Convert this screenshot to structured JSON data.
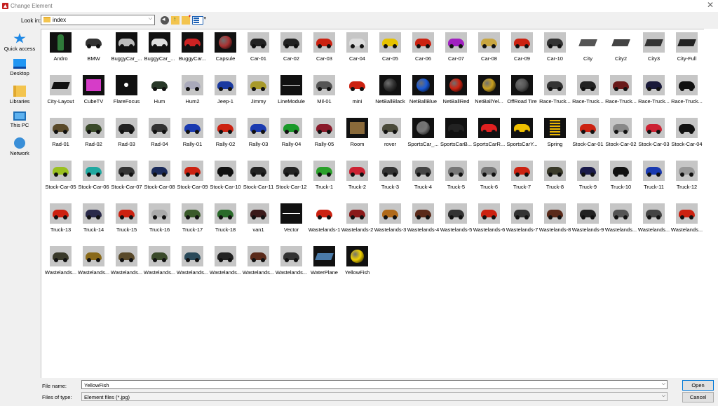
{
  "window": {
    "title": "Change Element",
    "close": "✕"
  },
  "lookin": {
    "label": "Look in:",
    "value": "index",
    "arrow": "⌵"
  },
  "sidebar": [
    {
      "label": "Quick access",
      "icon": "quick-access-icon"
    },
    {
      "label": "Desktop",
      "icon": "desktop-icon"
    },
    {
      "label": "Libraries",
      "icon": "libraries-icon"
    },
    {
      "label": "This PC",
      "icon": "this-pc-icon"
    },
    {
      "label": "Network",
      "icon": "network-icon"
    }
  ],
  "files": [
    {
      "n": "Andro",
      "k": "fig",
      "c": "#2f7a3a",
      "bg": "dark"
    },
    {
      "n": "BMW",
      "k": "car",
      "c": "#333",
      "bg": "white"
    },
    {
      "n": "BuggyCar_...",
      "k": "car",
      "c": "#bbb",
      "bg": "dark"
    },
    {
      "n": "BuggyCar_...",
      "k": "car",
      "c": "#ddd",
      "bg": "dark"
    },
    {
      "n": "BuggyCar...",
      "k": "car",
      "c": "#c22",
      "bg": "dark"
    },
    {
      "n": "Capsule",
      "k": "ball",
      "c": "#a33",
      "bg": "dark"
    },
    {
      "n": "Car-01",
      "k": "car",
      "c": "#222"
    },
    {
      "n": "Car-02",
      "k": "car",
      "c": "#222"
    },
    {
      "n": "Car-03",
      "k": "car",
      "c": "#c21"
    },
    {
      "n": "Car-04",
      "k": "car",
      "c": "#ddd"
    },
    {
      "n": "Car-05",
      "k": "car",
      "c": "#e6c200"
    },
    {
      "n": "Car-06",
      "k": "car",
      "c": "#c21"
    },
    {
      "n": "Car-07",
      "k": "car",
      "c": "#a020c0"
    },
    {
      "n": "Car-08",
      "k": "car",
      "c": "#c9a640"
    },
    {
      "n": "Car-09",
      "k": "car",
      "c": "#c21"
    },
    {
      "n": "Car-10",
      "k": "car",
      "c": "#333"
    },
    {
      "n": "City",
      "k": "slab",
      "c": "#555",
      "bg": "white"
    },
    {
      "n": "City2",
      "k": "slab",
      "c": "#444",
      "bg": "white"
    },
    {
      "n": "City3",
      "k": "slab",
      "c": "#333"
    },
    {
      "n": "City-Full",
      "k": "slab",
      "c": "#222"
    },
    {
      "n": "City-Layout",
      "k": "slab",
      "c": "#111"
    },
    {
      "n": "CubeTV",
      "k": "box",
      "c": "#d63cc8",
      "bg": "dark"
    },
    {
      "n": "FlareFocus",
      "k": "dot",
      "c": "#fff",
      "bg": "dark"
    },
    {
      "n": "Hum",
      "k": "car",
      "c": "#2a3a2a",
      "bg": "white"
    },
    {
      "n": "Hum2",
      "k": "car",
      "c": "#aab"
    },
    {
      "n": "Jeep-1",
      "k": "car",
      "c": "#1a3aa0"
    },
    {
      "n": "Jimmy",
      "k": "car",
      "c": "#a89a2a"
    },
    {
      "n": "LineModule",
      "k": "line",
      "c": "#fff",
      "bg": "dark"
    },
    {
      "n": "Mil-01",
      "k": "car",
      "c": "#555"
    },
    {
      "n": "mini",
      "k": "car",
      "c": "#c21",
      "bg": "white"
    },
    {
      "n": "NetBallBlack",
      "k": "ball",
      "c": "#333",
      "bg": "dark"
    },
    {
      "n": "NetBallBlue",
      "k": "ball",
      "c": "#1a5ad8",
      "bg": "dark"
    },
    {
      "n": "NetBallRed",
      "k": "ball",
      "c": "#c21",
      "bg": "dark"
    },
    {
      "n": "NetBallYel...",
      "k": "ball",
      "c": "#c9a020",
      "bg": "dark"
    },
    {
      "n": "OffRoad Tire",
      "k": "ball",
      "c": "#555",
      "bg": "dark"
    },
    {
      "n": "Race-Truck...",
      "k": "car",
      "c": "#333"
    },
    {
      "n": "Race-Truck...",
      "k": "car",
      "c": "#222"
    },
    {
      "n": "Race-Truck...",
      "k": "car",
      "c": "#6a1a1a"
    },
    {
      "n": "Race-Truck...",
      "k": "car",
      "c": "#1a1a3a"
    },
    {
      "n": "Race-Truck...",
      "k": "car",
      "c": "#111"
    },
    {
      "n": "Rad-01",
      "k": "car",
      "c": "#5a4a2a"
    },
    {
      "n": "Rad-02",
      "k": "car",
      "c": "#3a4a2a"
    },
    {
      "n": "Rad-03",
      "k": "car",
      "c": "#222"
    },
    {
      "n": "Rad-04",
      "k": "car",
      "c": "#333"
    },
    {
      "n": "Rally-01",
      "k": "car",
      "c": "#1a3ab0"
    },
    {
      "n": "Rally-02",
      "k": "car",
      "c": "#c21"
    },
    {
      "n": "Rally-03",
      "k": "car",
      "c": "#1a3ab0"
    },
    {
      "n": "Rally-04",
      "k": "car",
      "c": "#1a9a2a"
    },
    {
      "n": "Rally-05",
      "k": "car",
      "c": "#8a1a2a"
    },
    {
      "n": "Room",
      "k": "box",
      "c": "#8a6a3a",
      "bg": "dark"
    },
    {
      "n": "rover",
      "k": "car",
      "c": "#4a4a3a"
    },
    {
      "n": "SportsCar_...",
      "k": "ball",
      "c": "#777",
      "bg": "dark"
    },
    {
      "n": "SportsCarB...",
      "k": "car",
      "c": "#222",
      "bg": "dark"
    },
    {
      "n": "SportsCarR...",
      "k": "car",
      "c": "#e02020",
      "bg": "dark"
    },
    {
      "n": "SportsCarY...",
      "k": "car",
      "c": "#f0c000",
      "bg": "dark"
    },
    {
      "n": "Spring",
      "k": "coil",
      "c": "#e8b400",
      "bg": "dark"
    },
    {
      "n": "Stock-Car-01",
      "k": "car",
      "c": "#c21"
    },
    {
      "n": "Stock-Car-02",
      "k": "car",
      "c": "#888"
    },
    {
      "n": "Stock-Car-03",
      "k": "car",
      "c": "#c23"
    },
    {
      "n": "Stock-Car-04",
      "k": "car",
      "c": "#111"
    },
    {
      "n": "Stock-Car-05",
      "k": "car",
      "c": "#9ac020"
    },
    {
      "n": "Stock-Car-06",
      "k": "car",
      "c": "#20a8a0"
    },
    {
      "n": "Stock-Car-07",
      "k": "car",
      "c": "#333"
    },
    {
      "n": "Stock-Car-08",
      "k": "car",
      "c": "#1a2a5a"
    },
    {
      "n": "Stock-Car-09",
      "k": "car",
      "c": "#c21"
    },
    {
      "n": "Stock-Car-10",
      "k": "car",
      "c": "#111"
    },
    {
      "n": "Stock-Car-11",
      "k": "car",
      "c": "#222"
    },
    {
      "n": "Stock-Car-12",
      "k": "car",
      "c": "#222"
    },
    {
      "n": "Truck-1",
      "k": "car",
      "c": "#2aa02a"
    },
    {
      "n": "Truck-2",
      "k": "car",
      "c": "#c23"
    },
    {
      "n": "Truck-3",
      "k": "car",
      "c": "#333"
    },
    {
      "n": "Truck-4",
      "k": "car",
      "c": "#444"
    },
    {
      "n": "Truck-5",
      "k": "car",
      "c": "#777"
    },
    {
      "n": "Truck-6",
      "k": "car",
      "c": "#777"
    },
    {
      "n": "Truck-7",
      "k": "car",
      "c": "#c21"
    },
    {
      "n": "Truck-8",
      "k": "car",
      "c": "#3a3a2a"
    },
    {
      "n": "Truck-9",
      "k": "car",
      "c": "#1a1a4a"
    },
    {
      "n": "Truck-10",
      "k": "car",
      "c": "#111"
    },
    {
      "n": "Truck-11",
      "k": "car",
      "c": "#1a3ab0"
    },
    {
      "n": "Truck-12",
      "k": "car",
      "c": "#999"
    },
    {
      "n": "Truck-13",
      "k": "car",
      "c": "#c21"
    },
    {
      "n": "Truck-14",
      "k": "car",
      "c": "#2a2a4a"
    },
    {
      "n": "Truck-15",
      "k": "car",
      "c": "#c21"
    },
    {
      "n": "Truck-16",
      "k": "car",
      "c": "#aaa"
    },
    {
      "n": "Truck-17",
      "k": "car",
      "c": "#3a5a2a"
    },
    {
      "n": "Truck-18",
      "k": "car",
      "c": "#2a6a2a"
    },
    {
      "n": "van1",
      "k": "car",
      "c": "#3a1a1a"
    },
    {
      "n": "Vector",
      "k": "line",
      "c": "#fff",
      "bg": "dark"
    },
    {
      "n": "Wastelands-1",
      "k": "car",
      "c": "#c21",
      "bg": "white"
    },
    {
      "n": "Wastelands-2",
      "k": "car",
      "c": "#8a1a1a"
    },
    {
      "n": "Wastelands-3",
      "k": "car",
      "c": "#b06a1a"
    },
    {
      "n": "Wastelands-4",
      "k": "car",
      "c": "#5a2a1a"
    },
    {
      "n": "Wastelands-5",
      "k": "car",
      "c": "#333"
    },
    {
      "n": "Wastelands-6",
      "k": "car",
      "c": "#c21"
    },
    {
      "n": "Wastelands-7",
      "k": "car",
      "c": "#333"
    },
    {
      "n": "Wastelands-8",
      "k": "car",
      "c": "#5a2a1a"
    },
    {
      "n": "Wastelands-9",
      "k": "car",
      "c": "#222"
    },
    {
      "n": "Wastelands...",
      "k": "car",
      "c": "#555"
    },
    {
      "n": "Wastelands...",
      "k": "car",
      "c": "#444"
    },
    {
      "n": "Wastelands...",
      "k": "car",
      "c": "#c21"
    },
    {
      "n": "Wastelands...",
      "k": "car",
      "c": "#3a3a2a"
    },
    {
      "n": "Wastelands...",
      "k": "car",
      "c": "#8a6a1a"
    },
    {
      "n": "Wastelands...",
      "k": "car",
      "c": "#5a4a2a"
    },
    {
      "n": "Wastelands...",
      "k": "car",
      "c": "#3a4a2a"
    },
    {
      "n": "Wastelands...",
      "k": "car",
      "c": "#2a4a5a"
    },
    {
      "n": "Wastelands...",
      "k": "car",
      "c": "#222"
    },
    {
      "n": "Wastelands...",
      "k": "car",
      "c": "#5a2a1a"
    },
    {
      "n": "Wastelands...",
      "k": "car",
      "c": "#333"
    },
    {
      "n": "WaterPlane",
      "k": "slab",
      "c": "#4a7aa8",
      "bg": "dark"
    },
    {
      "n": "YellowFish",
      "k": "ball",
      "c": "#f0d000",
      "bg": "dark"
    }
  ],
  "file_name": {
    "label": "File name:",
    "value": "YellowFish",
    "arrow": "⌵"
  },
  "file_type": {
    "label": "Files of type:",
    "value": "Element files (*.jpg)",
    "arrow": "⌵"
  },
  "buttons": {
    "open": "Open",
    "cancel": "Cancel"
  }
}
